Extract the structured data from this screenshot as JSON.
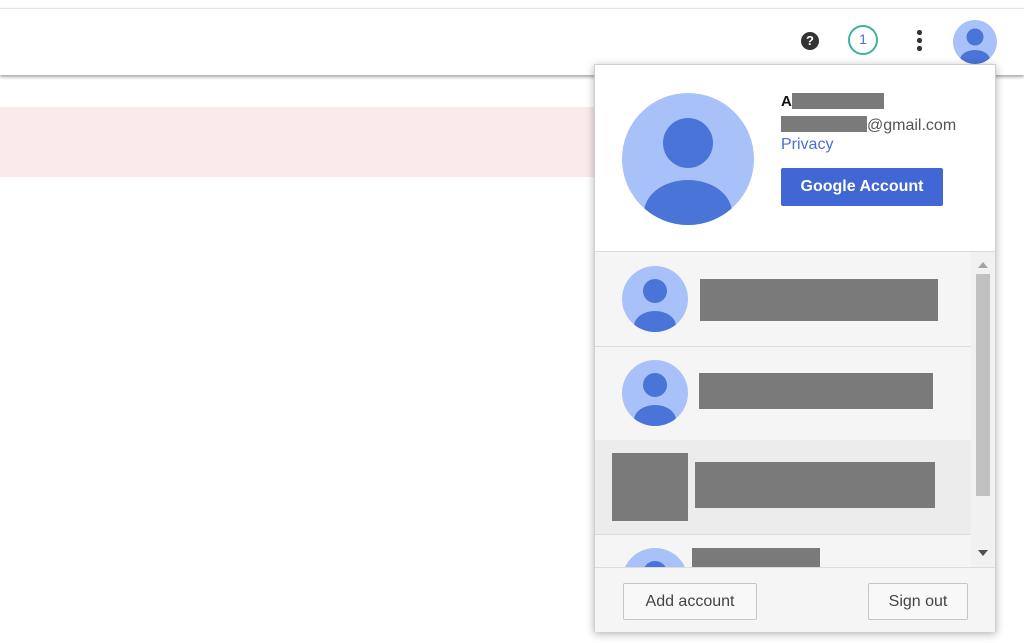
{
  "topbar": {
    "help_icon": "help-circle-icon",
    "help_glyph": "?",
    "notifications_count": "1",
    "more_icon": "more-vert-icon",
    "avatar_icon": "person-avatar-icon"
  },
  "account_panel": {
    "name_visible_initial": "A",
    "email_suffix": "@gmail.com",
    "privacy_label": "Privacy",
    "google_account_label": "Google Account",
    "avatar_icon": "person-avatar-icon",
    "accounts": [
      {
        "avatar": "person-avatar-icon",
        "redacted": true
      },
      {
        "avatar": "person-avatar-icon",
        "redacted": true
      },
      {
        "avatar": "redacted-image",
        "redacted": true
      },
      {
        "avatar": "person-avatar-icon",
        "redacted": true
      }
    ],
    "add_account_label": "Add account",
    "sign_out_label": "Sign out"
  },
  "colors": {
    "avatar_bg": "#a8c1f8",
    "avatar_fg": "#4a74d8",
    "primary_button": "#4167d4",
    "link": "#4a6fd6",
    "notification_ring": "#3eb39c",
    "redaction": "#7a7a7a",
    "banner": "#f8ebe9"
  }
}
